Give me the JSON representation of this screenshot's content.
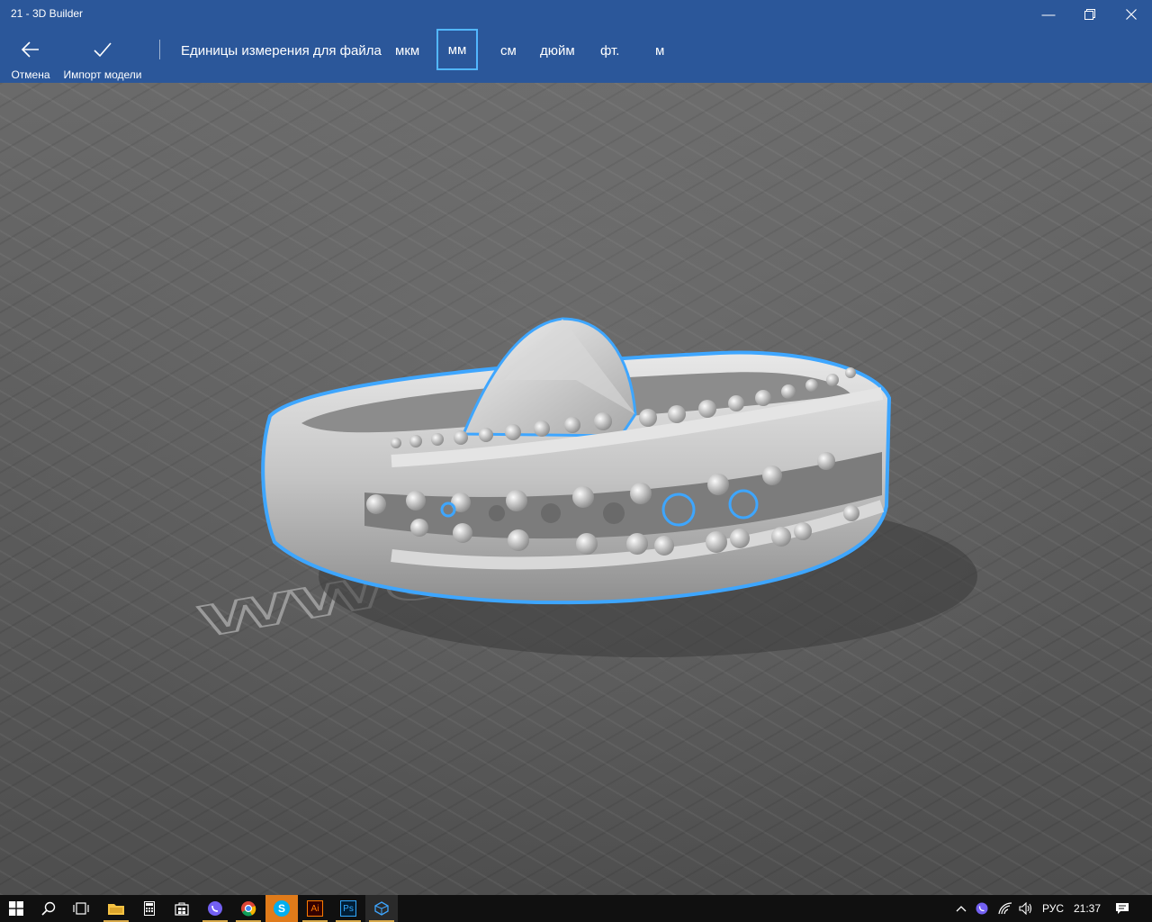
{
  "window": {
    "title": "21 - 3D Builder",
    "minimize_icon": "minimize-icon",
    "restore_icon": "restore-icon",
    "close_icon": "close-icon"
  },
  "toolbar": {
    "cancel_label": "Отмена",
    "cancel_icon": "back-arrow-icon",
    "import_label": "Импорт модели",
    "import_icon": "checkmark-icon",
    "units_label": "Единицы измерения для файла",
    "units": [
      "мкм",
      "мм",
      "см",
      "дюйм",
      "фт.",
      "м"
    ],
    "selected_unit": "мм"
  },
  "viewport": {
    "model": "ring-model",
    "floor_watermark": "WWO",
    "selection_color": "#3ea6ff"
  },
  "taskbar": {
    "pinned": [
      "start-icon",
      "search-icon",
      "task-view-icon",
      "file-explorer-icon",
      "calculator-icon",
      "store-icon",
      "viber-icon",
      "chrome-icon",
      "skype-icon",
      "illustrator-icon",
      "photoshop-icon",
      "3d-builder-icon"
    ],
    "illustrator_label": "Ai",
    "photoshop_label": "Ps",
    "skype_label": "S",
    "language": "РУС",
    "time": "21:37"
  },
  "colors": {
    "accent": "#2b579a",
    "selected_border": "#52b7ff",
    "taskbar": "#101010"
  }
}
